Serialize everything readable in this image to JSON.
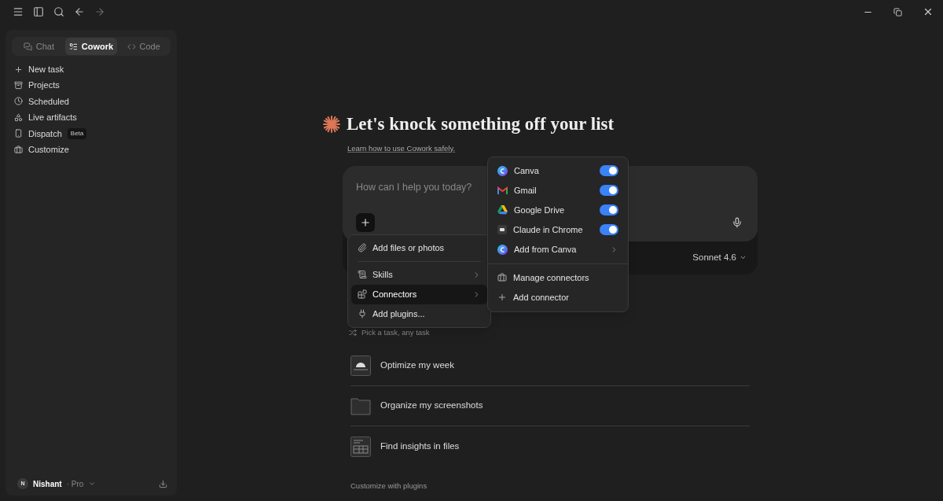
{
  "sidebar": {
    "tabs": [
      {
        "label": "Chat",
        "selected": false
      },
      {
        "label": "Cowork",
        "selected": true
      },
      {
        "label": "Code",
        "selected": false
      }
    ],
    "nav": [
      {
        "label": "New task"
      },
      {
        "label": "Projects"
      },
      {
        "label": "Scheduled"
      },
      {
        "label": "Live artifacts"
      },
      {
        "label": "Dispatch",
        "badge": "Beta"
      },
      {
        "label": "Customize"
      }
    ],
    "user": {
      "avatar": "N",
      "name": "Nishant",
      "plan": "· Pro"
    }
  },
  "main": {
    "heading": "Let's knock something off your list",
    "link": "Learn how to use Cowork safely.",
    "composer": {
      "placeholder": "How can I help you today?",
      "model": "Sonnet 4.6"
    },
    "tasks_hint": "Pick a task, any task",
    "tasks": [
      {
        "label": "Optimize my week"
      },
      {
        "label": "Organize my screenshots"
      },
      {
        "label": "Find insights in files"
      }
    ],
    "footer_link": "Customize with plugins"
  },
  "add_menu": {
    "items": [
      {
        "kind": "action",
        "label": "Add files or photos",
        "selected": false
      },
      {
        "kind": "submenu",
        "label": "Skills",
        "selected": false
      },
      {
        "kind": "submenu",
        "label": "Connectors",
        "selected": true
      },
      {
        "kind": "action",
        "label": "Add plugins...",
        "selected": false
      }
    ]
  },
  "connectors_menu": {
    "items": [
      {
        "kind": "toggle",
        "label": "Canva",
        "on": true
      },
      {
        "kind": "toggle",
        "label": "Gmail",
        "on": true
      },
      {
        "kind": "toggle",
        "label": "Google Drive",
        "on": true
      },
      {
        "kind": "toggle",
        "label": "Claude in Chrome",
        "on": true
      },
      {
        "kind": "submenu",
        "label": "Add from Canva"
      }
    ],
    "actions": [
      {
        "label": "Manage connectors"
      },
      {
        "label": "Add connector"
      }
    ]
  }
}
